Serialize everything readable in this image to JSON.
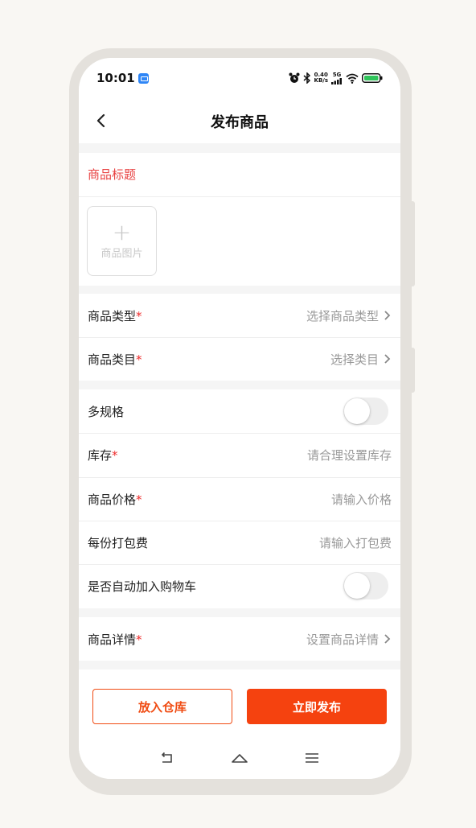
{
  "status_bar": {
    "time": "10:01",
    "net_speed_value": "0.40",
    "net_speed_unit": "KB/s",
    "network_type": "5G",
    "icons": [
      "alarm-icon",
      "bluetooth-icon",
      "signal-icon",
      "wifi-icon",
      "battery-icon"
    ]
  },
  "nav": {
    "title": "发布商品"
  },
  "form": {
    "title_placeholder": "商品标题",
    "image_upload_plus": "+",
    "image_upload_label": "商品图片",
    "product_type": {
      "label": "商品类型",
      "required_mark": "*",
      "value": "选择商品类型"
    },
    "product_category": {
      "label": "商品类目",
      "required_mark": "*",
      "value": "选择类目"
    },
    "multi_spec": {
      "label": "多规格",
      "enabled": false
    },
    "stock": {
      "label": "库存",
      "required_mark": "*",
      "placeholder": "请合理设置库存"
    },
    "price": {
      "label": "商品价格",
      "required_mark": "*",
      "placeholder": "请输入价格"
    },
    "packing_fee": {
      "label": "每份打包费",
      "placeholder": "请输入打包费"
    },
    "auto_cart": {
      "label": "是否自动加入购物车",
      "enabled": false
    },
    "details": {
      "label": "商品详情",
      "required_mark": "*",
      "value": "设置商品详情"
    }
  },
  "actions": {
    "save_to_warehouse": "放入仓库",
    "publish_now": "立即发布"
  },
  "colors": {
    "accent": "#f5420f",
    "required": "#ee2b2b",
    "title_hint": "#e84343"
  }
}
